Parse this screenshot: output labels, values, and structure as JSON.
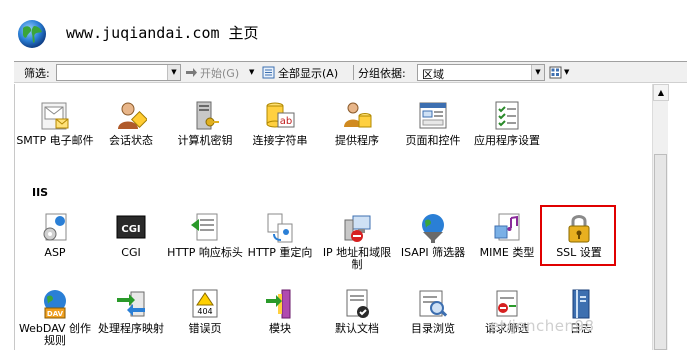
{
  "header": {
    "title": "www.juqiandai.com 主页"
  },
  "toolbar": {
    "filter_label": "筛选:",
    "start_label": "开始",
    "start_shortcut": "(G)",
    "show_all_label": "全部显示",
    "show_all_shortcut": "(A)",
    "group_label": "分组依据:",
    "group_value": "区域"
  },
  "row_top": [
    {
      "label": "SMTP 电子邮件"
    },
    {
      "label": "会话状态"
    },
    {
      "label": "计算机密钥"
    },
    {
      "label": "连接字符串"
    },
    {
      "label": "提供程序"
    },
    {
      "label": "页面和控件"
    },
    {
      "label": "应用程序设置"
    }
  ],
  "section": {
    "title": "IIS"
  },
  "row_iis": [
    {
      "label": "ASP"
    },
    {
      "label": "CGI"
    },
    {
      "label": "HTTP 响应标头"
    },
    {
      "label": "HTTP 重定向"
    },
    {
      "label": "IP 地址和域限制"
    },
    {
      "label": "ISAPI 筛选器"
    },
    {
      "label": "MIME 类型"
    },
    {
      "label": "SSL 设置"
    }
  ],
  "row_bottom": [
    {
      "label": "WebDAV 创作规则"
    },
    {
      "label": "处理程序映射"
    },
    {
      "label": "错误页"
    },
    {
      "label": "模块"
    },
    {
      "label": "默认文档"
    },
    {
      "label": "目录浏览"
    },
    {
      "label": "请求筛选"
    },
    {
      "label": "日志"
    }
  ],
  "watermark": "et/jonchen98",
  "icons": {
    "cgi_text": "CGI",
    "error_code": "404",
    "webdav_text": "DAV",
    "connection_text": "ab"
  },
  "colors": {
    "highlight": "#e00000"
  }
}
